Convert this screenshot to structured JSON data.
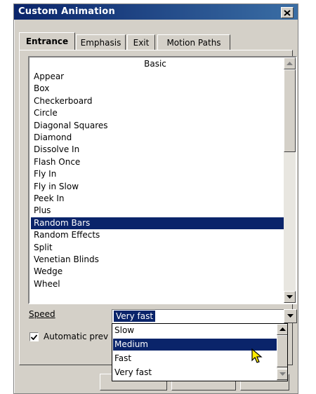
{
  "window": {
    "title": "Custom Animation"
  },
  "tabs": [
    {
      "label": "Entrance",
      "active": true
    },
    {
      "label": "Emphasis",
      "active": false
    },
    {
      "label": "Exit",
      "active": false
    },
    {
      "label": "Motion Paths",
      "active": false
    }
  ],
  "effects_list": {
    "header": "Basic",
    "items": [
      "Appear",
      "Box",
      "Checkerboard",
      "Circle",
      "Diagonal Squares",
      "Diamond",
      "Dissolve In",
      "Flash Once",
      "Fly In",
      "Fly in Slow",
      "Peek In",
      "Plus",
      "Random Bars",
      "Random Effects",
      "Split",
      "Venetian Blinds",
      "Wedge",
      "Wheel"
    ],
    "selected": "Random Bars"
  },
  "speed": {
    "label": "Speed",
    "value": "Very fast",
    "options": [
      "Slow",
      "Medium",
      "Fast",
      "Very fast"
    ],
    "highlighted": "Medium"
  },
  "automatic_preview": {
    "label": "Automatic prev",
    "checked": true
  },
  "colors": {
    "titlebar": "#0a246a",
    "selection": "#0a246a",
    "face": "#d4d0c8"
  },
  "icons": {
    "close": "close-icon",
    "cursor": "arrow-cursor-icon"
  }
}
